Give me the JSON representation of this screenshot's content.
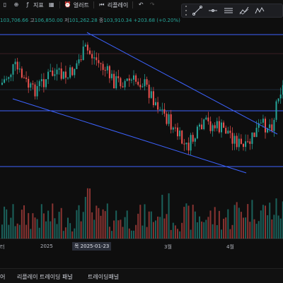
{
  "toolbar": {
    "items": [
      {
        "label": "",
        "icon": "compare-plus-icon"
      },
      {
        "label": "지표",
        "icon": "indicators-icon"
      },
      {
        "label": "",
        "icon": "layout-grid-icon"
      },
      {
        "label": "얼러트",
        "icon": "alert-clock-icon"
      },
      {
        "label": "리플레이",
        "icon": "replay-icon"
      }
    ],
    "undo": "↶",
    "redo": "↷"
  },
  "ohlc": {
    "open_value": "103,706.66",
    "high_label": "고",
    "high_value": "106,850.00",
    "low_label": "저",
    "low_value": "101,262.28",
    "close_label": "종",
    "close_value": "103,910.34",
    "change": "+203.68 (+0.20%)"
  },
  "drawing_tools": [
    "trend-line-icon",
    "horizontal-line-icon",
    "parallel-channel-icon",
    "fib-retracement-icon",
    "pattern-icon"
  ],
  "time_axis": {
    "labels": [
      "터",
      "2025",
      "3월",
      "4월"
    ],
    "cursor_label": "목 2025-01-23"
  },
  "bottom_tabs": [
    "어",
    "리플레이 트레이딩 패널",
    "트레이딩패널"
  ],
  "colors": {
    "up": "#26a69a",
    "down": "#ef5350",
    "line": "#3d63ff",
    "background": "#0e0e0e"
  }
}
